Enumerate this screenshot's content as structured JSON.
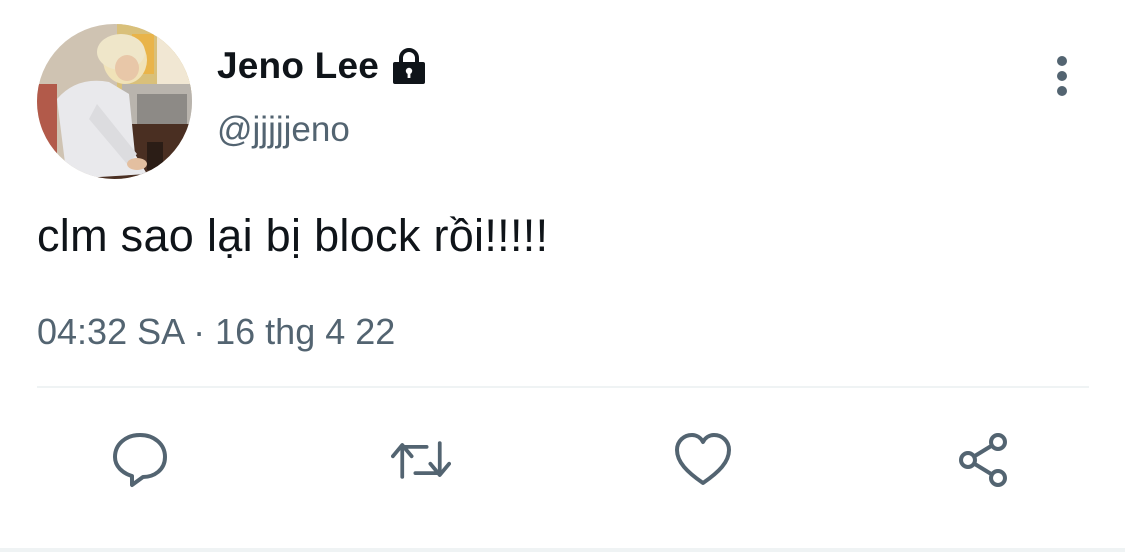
{
  "tweet": {
    "display_name": "Jeno Lee",
    "handle": "@jjjjjeno",
    "protected_icon": "lock-icon",
    "text": "clm sao lại bị block rồi!!!!!",
    "timestamp": "04:32 SA · 16 thg 4 22"
  },
  "actions": [
    {
      "name": "reply",
      "icon": "reply-icon"
    },
    {
      "name": "retweet",
      "icon": "retweet-icon"
    },
    {
      "name": "like",
      "icon": "heart-icon"
    },
    {
      "name": "share",
      "icon": "share-icon"
    }
  ],
  "more_icon": "more-vertical-icon",
  "colors": {
    "text_primary": "#0f1419",
    "text_secondary": "#536471",
    "divider": "#eff3f4",
    "background": "#ffffff"
  }
}
